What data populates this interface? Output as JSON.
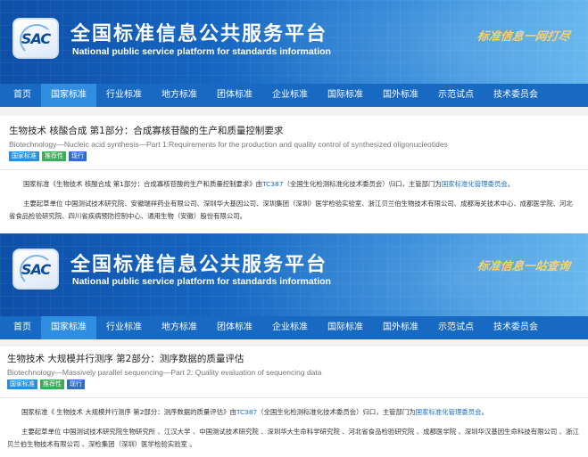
{
  "site": {
    "logo_text": "SAC",
    "title_cn": "全国标准信息公共服务平台",
    "title_en": "National public service platform  for standards information"
  },
  "nav": {
    "items": [
      {
        "label": "首页",
        "active": false
      },
      {
        "label": "国家标准",
        "active": true
      },
      {
        "label": "行业标准",
        "active": false
      },
      {
        "label": "地方标准",
        "active": false
      },
      {
        "label": "团体标准",
        "active": false
      },
      {
        "label": "企业标准",
        "active": false
      },
      {
        "label": "国际标准",
        "active": false
      },
      {
        "label": "国外标准",
        "active": false
      },
      {
        "label": "示范试点",
        "active": false
      },
      {
        "label": "技术委员会",
        "active": false
      }
    ]
  },
  "panels": [
    {
      "slogan": "标准信息一网打尽",
      "title": "生物技术 核酸合成 第1部分：合成寡核苷酸的生产和质量控制要求",
      "title_en": "Biotechnology—Nucleic acid synthesis—Part 1:Requirements for the production and quality control of synthesized oligonucleotides",
      "tags": [
        "国家标准",
        "推荐性",
        "现行"
      ],
      "para1_prefix": "国家标准《生物技术 核酸合成 第1部分：合成寡核苷酸的生产和质量控制要求》由",
      "para1_link1": "TC387",
      "para1_mid": "（全国生化检测标准化技术委员会）归口，主管部门为",
      "para1_link2": "国家标准化管理委员会",
      "para1_suffix": "。",
      "para2": "主要起草单位 中国测试技术研究院、安徽瑞祥药业有限公司、深圳华大基因公司、深圳集团（深圳）医学检验实验室、浙江贝兰伯生物技术有限公司、成都海关技术中心、成都医学院、河北省食品检验研究院、四川省疾病预防控制中心、通用生物（安徽）股份有限公司。"
    },
    {
      "slogan": "标准信息一站查询",
      "title": "生物技术 大规模并行测序 第2部分：测序数据的质量评估",
      "title_en": "Biotechnology—Massively parallel sequencing—Part 2: Quality evaluation of sequencing data",
      "tags": [
        "国家标准",
        "推荐性",
        "现行"
      ],
      "para1_prefix": "国家标准《 生物技术 大规模并行测序 第2部分：测序数据的质量评估》由",
      "para1_link1": "TC387",
      "para1_mid": "（全国生化检测标准化技术委员会）归口，主管部门为",
      "para1_link2": "国家标准化管理委员会",
      "para1_suffix": "。",
      "para2": "主要起草单位 中国测试技术研究院生物研究所 、江汉大学 、中国测试技术研究院 、深圳华大生命科学研究院 、河北省食品检验研究院 、成都医学院 、深圳华汉基因生命科技有限公司 、浙江贝兰伯生物技术有限公司 、深检集团（深圳）医学检验实验室 。"
    }
  ]
}
